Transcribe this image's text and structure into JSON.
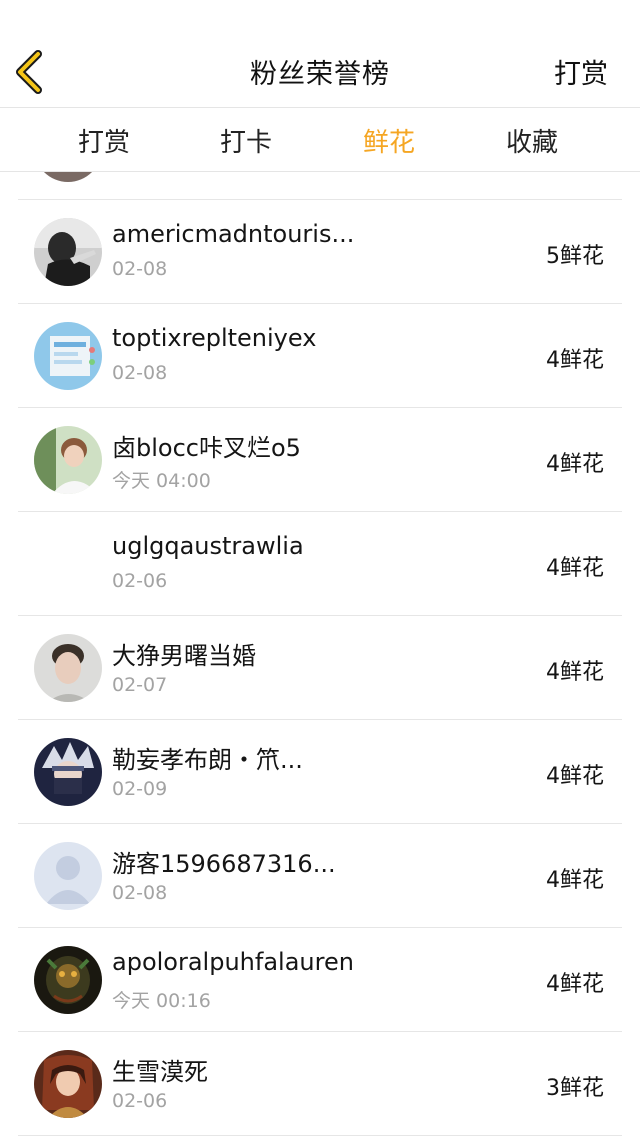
{
  "header": {
    "title": "粉丝荣誉榜",
    "right_action": "打赏"
  },
  "tabs": [
    {
      "label": "打赏"
    },
    {
      "label": "打卡"
    },
    {
      "label": "鲜花"
    },
    {
      "label": "收藏"
    }
  ],
  "active_tab": "鲜花",
  "accent_color": "#f5a623",
  "list": [
    {
      "name": "americmadntouris...",
      "date": "02-08",
      "count": "5鲜花",
      "avatar": "gray-photo-avatar"
    },
    {
      "name": "toptixreplteniyex",
      "date": "02-08",
      "count": "4鲜花",
      "avatar": "screenshot-avatar"
    },
    {
      "name": "卤blocc咔叉烂o5",
      "date": "今天 04:00",
      "count": "4鲜花",
      "avatar": "person-photo-avatar"
    },
    {
      "name": "uglgqaustrawlia",
      "date": "02-06",
      "count": "4鲜花",
      "avatar": "none"
    },
    {
      "name": "大狰男曙当婚",
      "date": "02-07",
      "count": "4鲜花",
      "avatar": "portrait-avatar"
    },
    {
      "name": "勒妄孝布朗・笊...",
      "date": "02-09",
      "count": "4鲜花",
      "avatar": "anime-avatar"
    },
    {
      "name": "游客1596687316...",
      "date": "02-08",
      "count": "4鲜花",
      "avatar": "default-user-avatar"
    },
    {
      "name": "apoloralpuhfalauren",
      "date": "今天 00:16",
      "count": "4鲜花",
      "avatar": "dark-art-avatar"
    },
    {
      "name": "生雪漠死",
      "date": "02-06",
      "count": "3鲜花",
      "avatar": "anime-girl-avatar"
    }
  ]
}
